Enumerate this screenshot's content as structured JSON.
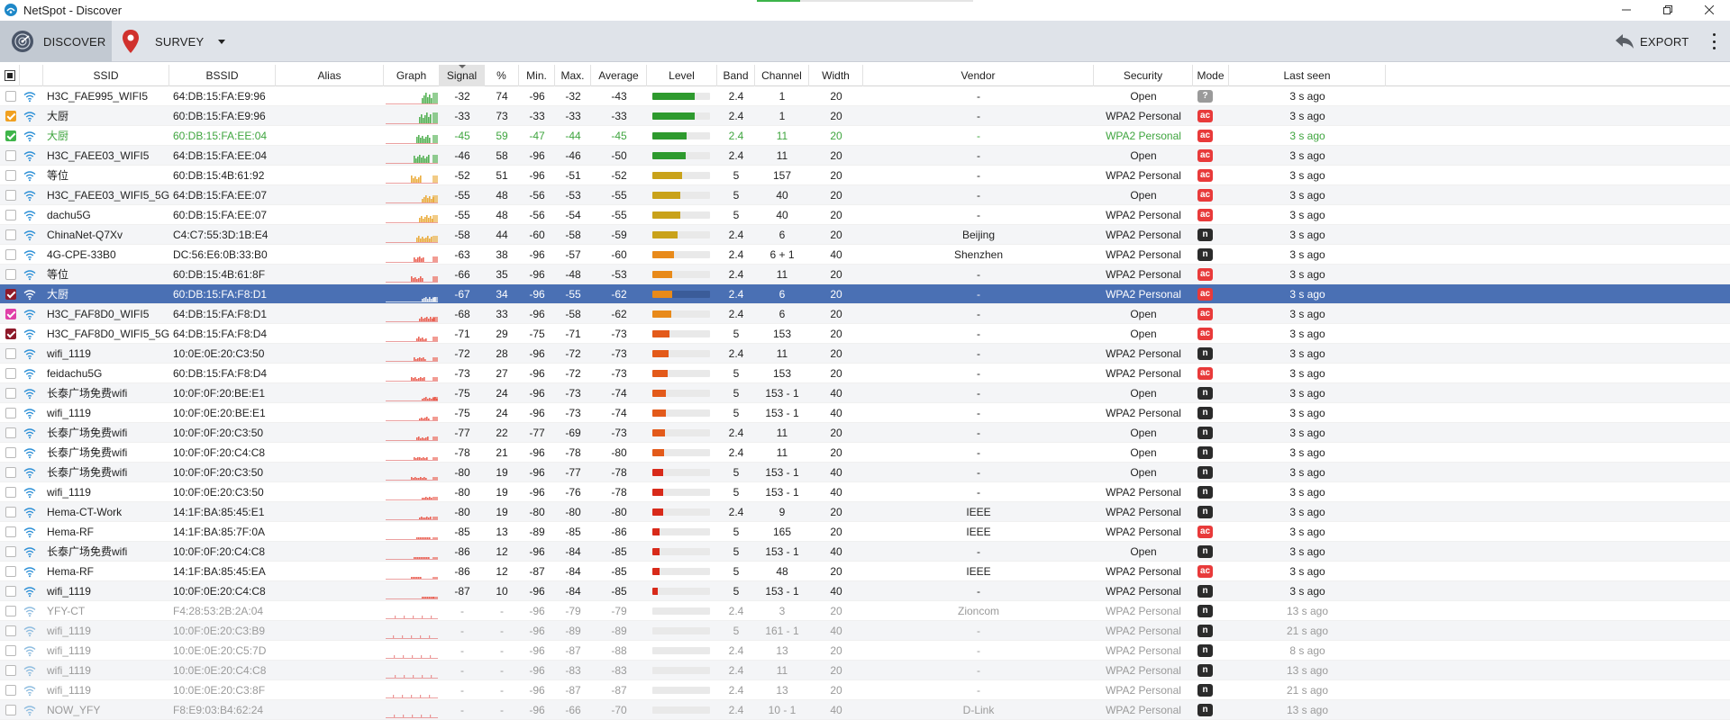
{
  "window": {
    "title": "NetSpot - Discover",
    "progress": 0.2
  },
  "toolbar": {
    "discover_label": "DISCOVER",
    "survey_label": "SURVEY",
    "export_label": "EXPORT"
  },
  "colors": {
    "accent_red": "#e83a3a",
    "selected_row": "#4a70b4",
    "green_row": "#3fa53f",
    "toolbar_bg": "#dfe3e9"
  },
  "icons": {
    "discover": "discover-radar-icon",
    "survey": "map-pin-icon",
    "export": "export-arrow-icon",
    "wifi": "wifi-icon",
    "more": "kebab-menu-icon"
  },
  "columns": [
    "SSID",
    "BSSID",
    "Alias",
    "Graph",
    "Signal",
    "%",
    "Min.",
    "Max.",
    "Average",
    "Level",
    "Band",
    "Channel",
    "Width",
    "Vendor",
    "Security",
    "Mode",
    "Last seen"
  ],
  "rows": [
    {
      "ssid": "H3C_FAE995_WIFI5",
      "bssid": "64:DB:15:FA:E9:96",
      "signal": "-32",
      "pct": "74",
      "min": "-96",
      "max": "-32",
      "avg": "-43",
      "level": 0.74,
      "band": "2.4",
      "channel": "1",
      "width": "20",
      "vendor": "-",
      "security": "Open",
      "mode": "?",
      "last": "3 s ago",
      "state": "normal",
      "check": ""
    },
    {
      "ssid": "大厨",
      "bssid": "60:DB:15:FA:E9:96",
      "signal": "-33",
      "pct": "73",
      "min": "-33",
      "max": "-33",
      "avg": "-33",
      "level": 0.73,
      "band": "2.4",
      "channel": "1",
      "width": "20",
      "vendor": "-",
      "security": "WPA2 Personal",
      "mode": "ac",
      "last": "3 s ago",
      "state": "alt",
      "check": "#f0a020"
    },
    {
      "ssid": "大厨",
      "bssid": "60:DB:15:FA:EE:04",
      "signal": "-45",
      "pct": "59",
      "min": "-47",
      "max": "-44",
      "avg": "-45",
      "level": 0.59,
      "band": "2.4",
      "channel": "11",
      "width": "20",
      "vendor": "-",
      "security": "WPA2 Personal",
      "mode": "ac",
      "last": "3 s ago",
      "state": "green",
      "check": "#3fb54a"
    },
    {
      "ssid": "H3C_FAEE03_WIFI5",
      "bssid": "64:DB:15:FA:EE:04",
      "signal": "-46",
      "pct": "58",
      "min": "-96",
      "max": "-46",
      "avg": "-50",
      "level": 0.58,
      "band": "2.4",
      "channel": "11",
      "width": "20",
      "vendor": "-",
      "security": "Open",
      "mode": "ac",
      "last": "3 s ago",
      "state": "alt",
      "check": ""
    },
    {
      "ssid": "等位",
      "bssid": "60:DB:15:4B:61:92",
      "signal": "-52",
      "pct": "51",
      "min": "-96",
      "max": "-51",
      "avg": "-52",
      "level": 0.51,
      "band": "5",
      "channel": "157",
      "width": "20",
      "vendor": "-",
      "security": "WPA2 Personal",
      "mode": "ac",
      "last": "3 s ago",
      "state": "normal",
      "check": ""
    },
    {
      "ssid": "H3C_FAEE03_WIFI5_5G",
      "bssid": "64:DB:15:FA:EE:07",
      "signal": "-55",
      "pct": "48",
      "min": "-56",
      "max": "-53",
      "avg": "-55",
      "level": 0.48,
      "band": "5",
      "channel": "40",
      "width": "20",
      "vendor": "-",
      "security": "Open",
      "mode": "ac",
      "last": "3 s ago",
      "state": "alt",
      "check": ""
    },
    {
      "ssid": "dachu5G",
      "bssid": "60:DB:15:FA:EE:07",
      "signal": "-55",
      "pct": "48",
      "min": "-56",
      "max": "-54",
      "avg": "-55",
      "level": 0.48,
      "band": "5",
      "channel": "40",
      "width": "20",
      "vendor": "-",
      "security": "WPA2 Personal",
      "mode": "ac",
      "last": "3 s ago",
      "state": "normal",
      "check": ""
    },
    {
      "ssid": "ChinaNet-Q7Xv",
      "bssid": "C4:C7:55:3D:1B:E4",
      "signal": "-58",
      "pct": "44",
      "min": "-60",
      "max": "-58",
      "avg": "-59",
      "level": 0.44,
      "band": "2.4",
      "channel": "6",
      "width": "20",
      "vendor": "Beijing",
      "security": "WPA2 Personal",
      "mode": "n",
      "last": "3 s ago",
      "state": "alt",
      "check": ""
    },
    {
      "ssid": "4G-CPE-33B0",
      "bssid": "DC:56:E6:0B:33:B0",
      "signal": "-63",
      "pct": "38",
      "min": "-96",
      "max": "-57",
      "avg": "-60",
      "level": 0.38,
      "band": "2.4",
      "channel": "6 + 1",
      "width": "40",
      "vendor": "Shenzhen",
      "security": "WPA2 Personal",
      "mode": "n",
      "last": "3 s ago",
      "state": "normal",
      "check": ""
    },
    {
      "ssid": "等位",
      "bssid": "60:DB:15:4B:61:8F",
      "signal": "-66",
      "pct": "35",
      "min": "-96",
      "max": "-48",
      "avg": "-53",
      "level": 0.35,
      "band": "2.4",
      "channel": "11",
      "width": "20",
      "vendor": "-",
      "security": "WPA2 Personal",
      "mode": "ac",
      "last": "3 s ago",
      "state": "alt",
      "check": ""
    },
    {
      "ssid": "大厨",
      "bssid": "60:DB:15:FA:F8:D1",
      "signal": "-67",
      "pct": "34",
      "min": "-96",
      "max": "-55",
      "avg": "-62",
      "level": 0.34,
      "band": "2.4",
      "channel": "6",
      "width": "20",
      "vendor": "-",
      "security": "WPA2 Personal",
      "mode": "ac",
      "last": "3 s ago",
      "state": "sel",
      "check": "#8e1a2a"
    },
    {
      "ssid": "H3C_FAF8D0_WIFI5",
      "bssid": "64:DB:15:FA:F8:D1",
      "signal": "-68",
      "pct": "33",
      "min": "-96",
      "max": "-58",
      "avg": "-62",
      "level": 0.33,
      "band": "2.4",
      "channel": "6",
      "width": "20",
      "vendor": "-",
      "security": "Open",
      "mode": "ac",
      "last": "3 s ago",
      "state": "alt",
      "check": "#e040a8"
    },
    {
      "ssid": "H3C_FAF8D0_WIFI5_5G",
      "bssid": "64:DB:15:FA:F8:D4",
      "signal": "-71",
      "pct": "29",
      "min": "-75",
      "max": "-71",
      "avg": "-73",
      "level": 0.29,
      "band": "5",
      "channel": "153",
      "width": "20",
      "vendor": "-",
      "security": "Open",
      "mode": "ac",
      "last": "3 s ago",
      "state": "normal",
      "check": "#8e1a2a"
    },
    {
      "ssid": "wifi_1119",
      "bssid": "10:0E:0E:20:C3:50",
      "signal": "-72",
      "pct": "28",
      "min": "-96",
      "max": "-72",
      "avg": "-73",
      "level": 0.28,
      "band": "2.4",
      "channel": "11",
      "width": "20",
      "vendor": "-",
      "security": "WPA2 Personal",
      "mode": "n",
      "last": "3 s ago",
      "state": "alt",
      "check": ""
    },
    {
      "ssid": "feidachu5G",
      "bssid": "60:DB:15:FA:F8:D4",
      "signal": "-73",
      "pct": "27",
      "min": "-96",
      "max": "-72",
      "avg": "-73",
      "level": 0.27,
      "band": "5",
      "channel": "153",
      "width": "20",
      "vendor": "-",
      "security": "WPA2 Personal",
      "mode": "ac",
      "last": "3 s ago",
      "state": "normal",
      "check": ""
    },
    {
      "ssid": "长泰广场免费wifi",
      "bssid": "10:0F:0F:20:BE:E1",
      "signal": "-75",
      "pct": "24",
      "min": "-96",
      "max": "-73",
      "avg": "-74",
      "level": 0.24,
      "band": "5",
      "channel": "153 - 1",
      "width": "40",
      "vendor": "-",
      "security": "Open",
      "mode": "n",
      "last": "3 s ago",
      "state": "alt",
      "check": ""
    },
    {
      "ssid": "wifi_1119",
      "bssid": "10:0F:0E:20:BE:E1",
      "signal": "-75",
      "pct": "24",
      "min": "-96",
      "max": "-73",
      "avg": "-74",
      "level": 0.24,
      "band": "5",
      "channel": "153 - 1",
      "width": "40",
      "vendor": "-",
      "security": "WPA2 Personal",
      "mode": "n",
      "last": "3 s ago",
      "state": "normal",
      "check": ""
    },
    {
      "ssid": "长泰广场免费wifi",
      "bssid": "10:0F:0F:20:C3:50",
      "signal": "-77",
      "pct": "22",
      "min": "-77",
      "max": "-69",
      "avg": "-73",
      "level": 0.22,
      "band": "2.4",
      "channel": "11",
      "width": "20",
      "vendor": "-",
      "security": "Open",
      "mode": "n",
      "last": "3 s ago",
      "state": "alt",
      "check": ""
    },
    {
      "ssid": "长泰广场免费wifi",
      "bssid": "10:0F:0F:20:C4:C8",
      "signal": "-78",
      "pct": "21",
      "min": "-96",
      "max": "-78",
      "avg": "-80",
      "level": 0.21,
      "band": "2.4",
      "channel": "11",
      "width": "20",
      "vendor": "-",
      "security": "Open",
      "mode": "n",
      "last": "3 s ago",
      "state": "normal",
      "check": ""
    },
    {
      "ssid": "长泰广场免费wifi",
      "bssid": "10:0F:0F:20:C3:50",
      "signal": "-80",
      "pct": "19",
      "min": "-96",
      "max": "-77",
      "avg": "-78",
      "level": 0.19,
      "band": "5",
      "channel": "153 - 1",
      "width": "40",
      "vendor": "-",
      "security": "Open",
      "mode": "n",
      "last": "3 s ago",
      "state": "alt",
      "check": ""
    },
    {
      "ssid": "wifi_1119",
      "bssid": "10:0F:0E:20:C3:50",
      "signal": "-80",
      "pct": "19",
      "min": "-96",
      "max": "-76",
      "avg": "-78",
      "level": 0.19,
      "band": "5",
      "channel": "153 - 1",
      "width": "40",
      "vendor": "-",
      "security": "WPA2 Personal",
      "mode": "n",
      "last": "3 s ago",
      "state": "normal",
      "check": ""
    },
    {
      "ssid": "Hema-CT-Work",
      "bssid": "14:1F:BA:85:45:E1",
      "signal": "-80",
      "pct": "19",
      "min": "-80",
      "max": "-80",
      "avg": "-80",
      "level": 0.19,
      "band": "2.4",
      "channel": "9",
      "width": "20",
      "vendor": "IEEE",
      "security": "WPA2 Personal",
      "mode": "n",
      "last": "3 s ago",
      "state": "alt",
      "check": ""
    },
    {
      "ssid": "Hema-RF",
      "bssid": "14:1F:BA:85:7F:0A",
      "signal": "-85",
      "pct": "13",
      "min": "-89",
      "max": "-85",
      "avg": "-86",
      "level": 0.13,
      "band": "5",
      "channel": "165",
      "width": "20",
      "vendor": "IEEE",
      "security": "WPA2 Personal",
      "mode": "ac",
      "last": "3 s ago",
      "state": "normal",
      "check": ""
    },
    {
      "ssid": "长泰广场免费wifi",
      "bssid": "10:0F:0F:20:C4:C8",
      "signal": "-86",
      "pct": "12",
      "min": "-96",
      "max": "-84",
      "avg": "-85",
      "level": 0.12,
      "band": "5",
      "channel": "153 - 1",
      "width": "40",
      "vendor": "-",
      "security": "Open",
      "mode": "n",
      "last": "3 s ago",
      "state": "alt",
      "check": ""
    },
    {
      "ssid": "Hema-RF",
      "bssid": "14:1F:BA:85:45:EA",
      "signal": "-86",
      "pct": "12",
      "min": "-87",
      "max": "-84",
      "avg": "-85",
      "level": 0.12,
      "band": "5",
      "channel": "48",
      "width": "20",
      "vendor": "IEEE",
      "security": "WPA2 Personal",
      "mode": "ac",
      "last": "3 s ago",
      "state": "normal",
      "check": ""
    },
    {
      "ssid": "wifi_1119",
      "bssid": "10:0F:0E:20:C4:C8",
      "signal": "-87",
      "pct": "10",
      "min": "-96",
      "max": "-84",
      "avg": "-85",
      "level": 0.1,
      "band": "5",
      "channel": "153 - 1",
      "width": "40",
      "vendor": "-",
      "security": "WPA2 Personal",
      "mode": "n",
      "last": "3 s ago",
      "state": "alt",
      "check": ""
    },
    {
      "ssid": "YFY-CT",
      "bssid": "F4:28:53:2B:2A:04",
      "signal": "-",
      "pct": "-",
      "min": "-96",
      "max": "-79",
      "avg": "-79",
      "level": 0,
      "band": "2.4",
      "channel": "3",
      "width": "20",
      "vendor": "Zioncom",
      "security": "WPA2 Personal",
      "mode": "n",
      "last": "13 s ago",
      "state": "gray",
      "check": ""
    },
    {
      "ssid": "wifi_1119",
      "bssid": "10:0F:0E:20:C3:B9",
      "signal": "-",
      "pct": "-",
      "min": "-96",
      "max": "-89",
      "avg": "-89",
      "level": 0,
      "band": "5",
      "channel": "161 - 1",
      "width": "40",
      "vendor": "-",
      "security": "WPA2 Personal",
      "mode": "n",
      "last": "21 s ago",
      "state": "gray-alt",
      "check": ""
    },
    {
      "ssid": "wifi_1119",
      "bssid": "10:0E:0E:20:C5:7D",
      "signal": "-",
      "pct": "-",
      "min": "-96",
      "max": "-87",
      "avg": "-88",
      "level": 0,
      "band": "2.4",
      "channel": "13",
      "width": "20",
      "vendor": "-",
      "security": "WPA2 Personal",
      "mode": "n",
      "last": "8 s ago",
      "state": "gray",
      "check": ""
    },
    {
      "ssid": "wifi_1119",
      "bssid": "10:0E:0E:20:C4:C8",
      "signal": "-",
      "pct": "-",
      "min": "-96",
      "max": "-83",
      "avg": "-83",
      "level": 0,
      "band": "2.4",
      "channel": "11",
      "width": "20",
      "vendor": "-",
      "security": "WPA2 Personal",
      "mode": "n",
      "last": "13 s ago",
      "state": "gray-alt",
      "check": ""
    },
    {
      "ssid": "wifi_1119",
      "bssid": "10:0E:0E:20:C3:8F",
      "signal": "-",
      "pct": "-",
      "min": "-96",
      "max": "-87",
      "avg": "-87",
      "level": 0,
      "band": "2.4",
      "channel": "13",
      "width": "20",
      "vendor": "-",
      "security": "WPA2 Personal",
      "mode": "n",
      "last": "21 s ago",
      "state": "gray",
      "check": ""
    },
    {
      "ssid": "NOW_YFY",
      "bssid": "F8:E9:03:B4:62:24",
      "signal": "-",
      "pct": "-",
      "min": "-96",
      "max": "-66",
      "avg": "-70",
      "level": 0,
      "band": "2.4",
      "channel": "10 - 1",
      "width": "40",
      "vendor": "D-Link",
      "security": "WPA2 Personal",
      "mode": "n",
      "last": "13 s ago",
      "state": "gray-alt",
      "check": ""
    }
  ]
}
